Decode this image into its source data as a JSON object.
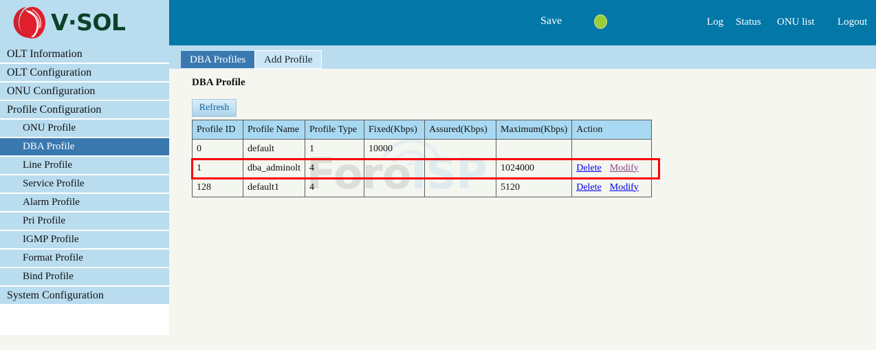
{
  "brand": {
    "name": "V·SOL",
    "logo_icon": "vsol-swirl-logo-icon"
  },
  "header": {
    "save_label": "Save",
    "status_indicator": "green-status-dot",
    "status_color": "#9ccd3a",
    "links": [
      {
        "label": "Log",
        "name": "log"
      },
      {
        "label": "Status",
        "name": "status"
      },
      {
        "label": "ONU list",
        "name": "onu-list"
      }
    ],
    "logout_label": "Logout",
    "bar_color": "#0277a8"
  },
  "tabs": [
    {
      "label": "DBA Profiles",
      "active": true
    },
    {
      "label": "Add Profile",
      "active": false
    }
  ],
  "sidebar": {
    "items": [
      {
        "label": "OLT Information",
        "level": 0,
        "selected": false
      },
      {
        "label": "OLT Configuration",
        "level": 0,
        "selected": false
      },
      {
        "label": "ONU Configuration",
        "level": 0,
        "selected": false
      },
      {
        "label": "Profile Configuration",
        "level": 0,
        "selected": false
      },
      {
        "label": "ONU Profile",
        "level": 1,
        "selected": false
      },
      {
        "label": "DBA Profile",
        "level": 1,
        "selected": true
      },
      {
        "label": "Line Profile",
        "level": 1,
        "selected": false
      },
      {
        "label": "Service Profile",
        "level": 1,
        "selected": false
      },
      {
        "label": "Alarm Profile",
        "level": 1,
        "selected": false
      },
      {
        "label": "Pri Profile",
        "level": 1,
        "selected": false
      },
      {
        "label": "IGMP Profile",
        "level": 1,
        "selected": false
      },
      {
        "label": "Format Profile",
        "level": 1,
        "selected": false
      },
      {
        "label": "Bind Profile",
        "level": 1,
        "selected": false
      },
      {
        "label": "System Configuration",
        "level": 0,
        "selected": false
      }
    ]
  },
  "main": {
    "page_title": "DBA Profile",
    "refresh_label": "Refresh",
    "table": {
      "headers": [
        "Profile ID",
        "Profile Name",
        "Profile Type",
        "Fixed(Kbps)",
        "Assured(Kbps)",
        "Maximum(Kbps)",
        "Action"
      ],
      "rows": [
        {
          "profile_id": "0",
          "profile_name": "default",
          "profile_type": "1",
          "fixed": "10000",
          "assured": "",
          "maximum": "",
          "actions": [],
          "highlighted": false
        },
        {
          "profile_id": "1",
          "profile_name": "dba_adminolt",
          "profile_type": "4",
          "fixed": "",
          "assured": "",
          "maximum": "1024000",
          "actions": [
            {
              "label": "Delete",
              "visited": false
            },
            {
              "label": "Modify",
              "visited": true
            }
          ],
          "highlighted": true
        },
        {
          "profile_id": "128",
          "profile_name": "default1",
          "profile_type": "4",
          "fixed": "",
          "assured": "",
          "maximum": "5120",
          "actions": [
            {
              "label": "Delete",
              "visited": false
            },
            {
              "label": "Modify",
              "visited": false
            }
          ],
          "highlighted": false
        }
      ]
    },
    "highlight_color": "#ff0000"
  },
  "watermark": {
    "text_primary": "Foro",
    "text_secondary": "ISP"
  }
}
